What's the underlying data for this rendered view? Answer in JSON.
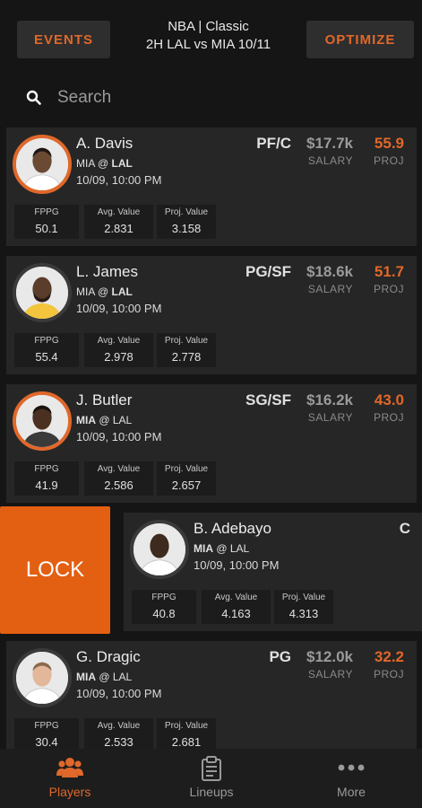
{
  "header": {
    "events_label": "EVENTS",
    "title_line1": "NBA | Classic",
    "title_line2": "2H LAL vs MIA  10/11",
    "optimize_label": "OPTIMIZE"
  },
  "search": {
    "placeholder": "Search"
  },
  "stat_labels": {
    "fppg": "FPPG",
    "avg_value": "Avg. Value",
    "proj_value": "Proj. Value"
  },
  "col_labels": {
    "salary": "SALARY",
    "proj": "PROJ"
  },
  "players": [
    {
      "name": "A. Davis",
      "away": "MIA",
      "at": " @ ",
      "home": "LAL",
      "bold": "home",
      "time": "10/09, 10:00 PM",
      "position": "PF/C",
      "salary": "$17.7k",
      "proj": "55.9",
      "fppg": "50.1",
      "avg_value": "2.831",
      "proj_value": "3.158",
      "locked": true
    },
    {
      "name": "L. James",
      "away": "MIA",
      "at": " @ ",
      "home": "LAL",
      "bold": "home",
      "time": "10/09, 10:00 PM",
      "position": "PG/SF",
      "salary": "$18.6k",
      "proj": "51.7",
      "fppg": "55.4",
      "avg_value": "2.978",
      "proj_value": "2.778",
      "locked": false
    },
    {
      "name": "J. Butler",
      "away": "MIA",
      "at": " @ ",
      "home": "LAL",
      "bold": "away",
      "time": "10/09, 10:00 PM",
      "position": "SG/SF",
      "salary": "$16.2k",
      "proj": "43.0",
      "fppg": "41.9",
      "avg_value": "2.586",
      "proj_value": "2.657",
      "locked": true
    },
    {
      "name": "B. Adebayo",
      "away": "MIA",
      "at": " @ ",
      "home": "LAL",
      "bold": "away",
      "time": "10/09, 10:00 PM",
      "position": "C",
      "salary": "",
      "proj": "",
      "fppg": "40.8",
      "avg_value": "4.163",
      "proj_value": "4.313",
      "locked": false
    },
    {
      "name": "G. Dragic",
      "away": "MIA",
      "at": " @ ",
      "home": "LAL",
      "bold": "away",
      "time": "10/09, 10:00 PM",
      "position": "PG",
      "salary": "$12.0k",
      "proj": "32.2",
      "fppg": "30.4",
      "avg_value": "2.533",
      "proj_value": "2.681",
      "locked": false
    }
  ],
  "swipe_action": {
    "label": "LOCK"
  },
  "tabs": [
    {
      "label": "Players",
      "icon": "people-icon",
      "active": true
    },
    {
      "label": "Lineups",
      "icon": "clipboard-icon",
      "active": false
    },
    {
      "label": "More",
      "icon": "more-dots-icon",
      "active": false
    }
  ],
  "colors": {
    "accent": "#e0682a",
    "lock": "#e35f12",
    "card": "#262626",
    "background": "#151515"
  }
}
